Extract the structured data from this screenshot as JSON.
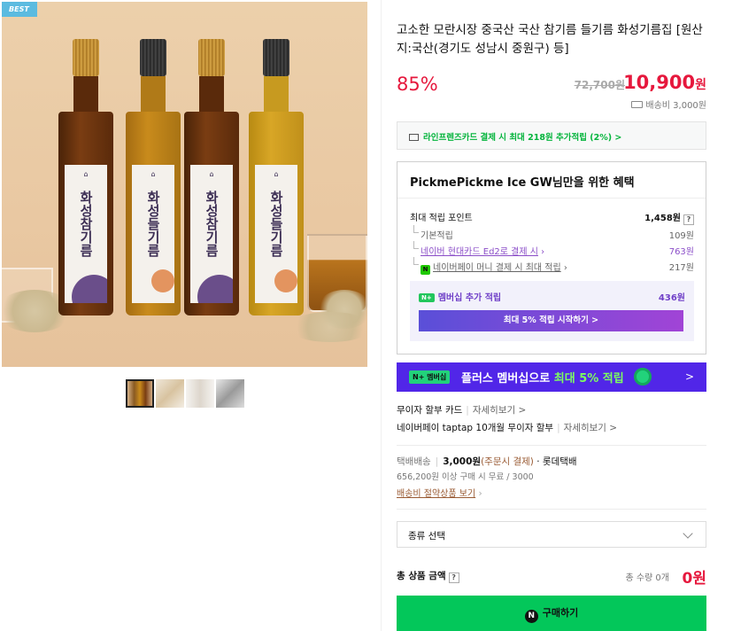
{
  "badge": "BEST",
  "product": {
    "bottles": [
      {
        "label": "화성참기름",
        "color": "#7a3d12"
      },
      {
        "label": "화성들기름",
        "color": "#c98b1c"
      },
      {
        "label": "화성참기름",
        "color": "#7a3d12"
      },
      {
        "label": "화성들기름",
        "color": "#d8a626"
      }
    ],
    "title": "고소한 모란시장 중국산 국산 참기름 들기름 화성기름집 [원산지:국산(경기도 성남시 중원구) 등]",
    "discount_rate": "85%",
    "original_price": "72,700원",
    "sale_price": "10,900",
    "sale_price_unit": "원",
    "shipping_fee": "배송비 3,000원"
  },
  "card_promo": "라인프렌즈카드 결제 시 최대 218원 추가적립 (2%) >",
  "benefits": {
    "title": "PickmePickme Ice GW님만을 위한 혜택",
    "max_points_label": "최대 적립 포인트",
    "max_points_value": "1,458원",
    "help_icon": "?",
    "rows": [
      {
        "label": "기본적립",
        "value": "109원"
      },
      {
        "label": "네이버 현대카드 Ed2로 결제 시",
        "value": "763원"
      },
      {
        "label": "네이버페이 머니 결제 시 최대 적립",
        "value": "217원"
      }
    ],
    "membership_badge": "N+",
    "membership_label": "멤버십 추가 적립",
    "membership_value": "436원",
    "membership_button": "최대 5% 적립 시작하기 >"
  },
  "banner": {
    "tag": "N+ 멤버십",
    "text": "플러스 멤버십으로",
    "highlight": "최대 5% 적립",
    "arrow": ">"
  },
  "installments": [
    {
      "label": "무이자 할부 카드",
      "more": "자세히보기 >"
    },
    {
      "label": "네이버페이 taptap 10개월 무이자 할부",
      "more": "자세히보기 >"
    }
  ],
  "delivery": {
    "method": "택배배송",
    "fee": "3,000원",
    "fee_note": "(주문시 결제)",
    "carrier": "· 롯데택배",
    "free_condition": "656,200원 이상 구매 시 무료 / 3000",
    "saving_link": "배송비 절약상품 보기"
  },
  "option_select": {
    "placeholder": "종류 선택"
  },
  "total": {
    "label": "총 상품 금액",
    "count": "총 수량 0개",
    "amount": "0원"
  },
  "buy_button": {
    "icon": "N",
    "label": "구매하기"
  }
}
